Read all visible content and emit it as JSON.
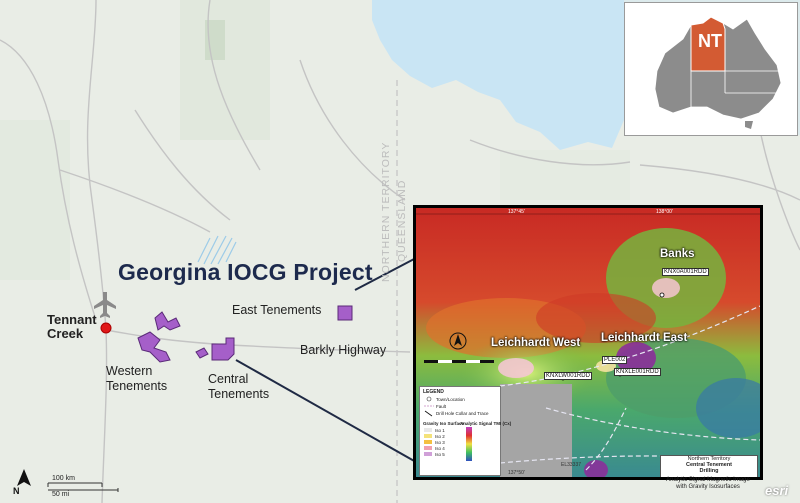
{
  "project_title": "Georgina IOCG Project",
  "inset": {
    "state_label": "NT",
    "state_color": "#d35b33",
    "land_color": "#8c8c8c"
  },
  "towns": {
    "tennant_creek": "Tennant\nCreek"
  },
  "labels": {
    "east_tenements": "East Tenements",
    "western_tenements": "Western\nTenements",
    "central_tenements": "Central\nTenements",
    "barkly_highway": "Barkly Highway",
    "northern_territory": "NORTHERN TERRITORY",
    "queensland": "QUEENSLAND"
  },
  "panel": {
    "banks": "Banks",
    "leichhardt_west": "Leichhardt West",
    "leichhardt_east": "Leichhardt East",
    "drill_holes": {
      "banks": "KNX0A001RDD",
      "lw": "KNXLW001RDD",
      "le": "KNXLE001RDD",
      "le_small": "PLE002"
    },
    "legend": {
      "title": "LEGEND",
      "items": [
        "Town/Location",
        "Fault",
        "Drill Hole Collar and Trace"
      ],
      "gravity_title": "Gravity Iso Surface",
      "signal_title": "Analytic Signal TMI (Cx)",
      "iso_levels": [
        "Iso 1",
        "Iso 2",
        "Iso 3",
        "Iso 4",
        "Iso 5"
      ]
    },
    "title_box": [
      "Northern Territory",
      "Central Tenement",
      "Drilling",
      "Analytic Signal Magnetic Image",
      "with Gravity Isosurfaces"
    ],
    "el_label": "EL33337",
    "coords": [
      "137°45'",
      "137°50'",
      "138°00'"
    ]
  },
  "scale": {
    "km": "100 km",
    "mi": "50 mi"
  },
  "north": "N",
  "attribution": "esri",
  "colors": {
    "tenement": "#a55fc9",
    "town_dot": "#e01818",
    "water": "#c9e5f4",
    "land": "#e9ede6"
  }
}
